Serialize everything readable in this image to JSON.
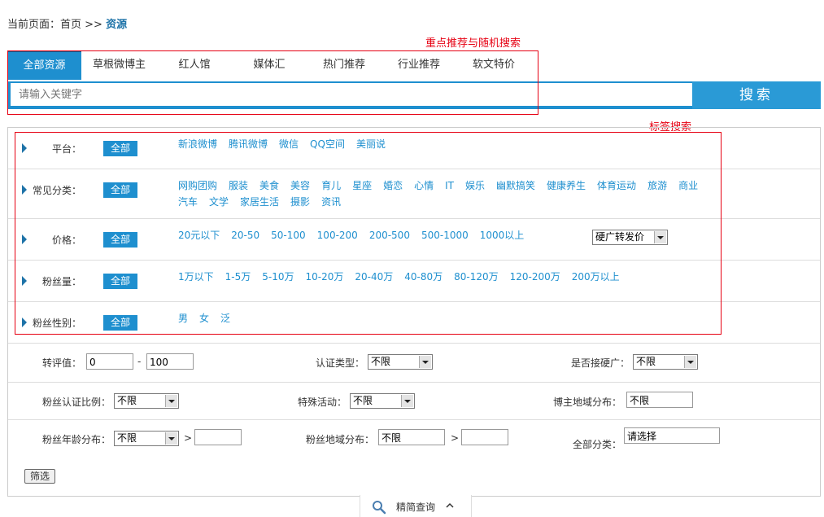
{
  "breadcrumb": {
    "prefix": "当前页面：首页 >> ",
    "current": "资源"
  },
  "annotations": {
    "recommend": "重点推荐与随机搜索",
    "tags": "标签搜索"
  },
  "tabs": [
    "全部资源",
    "草根微博主",
    "红人馆",
    "媒体汇",
    "热门推荐",
    "行业推荐",
    "软文特价"
  ],
  "search": {
    "placeholder": "请输入关键字",
    "button": "搜索"
  },
  "filters": {
    "all_label": "全部",
    "platform": {
      "label": "平台：",
      "options": [
        "新浪微博",
        "腾讯微博",
        "微信",
        "QQ空间",
        "美丽说"
      ]
    },
    "category": {
      "label": "常见分类：",
      "options": [
        "网购团购",
        "服装",
        "美食",
        "美容",
        "育儿",
        "星座",
        "婚恋",
        "心情",
        "IT",
        "娱乐",
        "幽默搞笑",
        "健康养生",
        "体育运动",
        "旅游",
        "商业",
        "汽车",
        "文学",
        "家居生活",
        "摄影",
        "资讯"
      ]
    },
    "price": {
      "label": "价格：",
      "options": [
        "20元以下",
        "20-50",
        "50-100",
        "100-200",
        "200-500",
        "500-1000",
        "1000以上"
      ],
      "select": "硬广转发价"
    },
    "fans": {
      "label": "粉丝量：",
      "options": [
        "1万以下",
        "1-5万",
        "5-10万",
        "10-20万",
        "20-40万",
        "40-80万",
        "80-120万",
        "120-200万",
        "200万以上"
      ]
    },
    "gender": {
      "label": "粉丝性别：",
      "options": [
        "男",
        "女",
        "泛"
      ]
    }
  },
  "adv": {
    "repost": {
      "label": "转评值：",
      "from": "0",
      "dash": "-",
      "to": "100"
    },
    "auth_type": {
      "label": "认证类型：",
      "value": "不限"
    },
    "hard_ad": {
      "label": "是否接硬广：",
      "value": "不限"
    },
    "fan_auth": {
      "label": "粉丝认证比例：",
      "value": "不限"
    },
    "special": {
      "label": "特殊活动：",
      "value": "不限"
    },
    "region": {
      "label": "博主地域分布：",
      "value": "不限"
    },
    "age": {
      "label": "粉丝年龄分布：",
      "value": "不限",
      "gt": ">"
    },
    "fan_region": {
      "label": "粉丝地域分布：",
      "value": "不限",
      "gt": ">"
    },
    "all_cat": {
      "label": "全部分类：",
      "value": "请选择"
    }
  },
  "filter_button": "筛选",
  "toggle": {
    "label": "精简查询"
  },
  "colors": {
    "accent": "#1e8fcf",
    "annotation": "#e60012"
  }
}
